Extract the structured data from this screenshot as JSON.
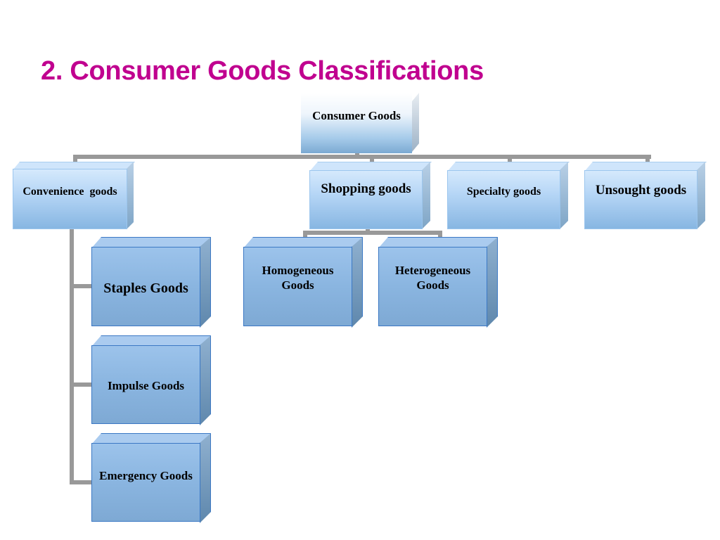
{
  "slide": {
    "title": "2. Consumer Goods Classifications"
  },
  "diagram": {
    "root": {
      "label": "Consumer Goods"
    },
    "categories": [
      {
        "label": "Convenience  goods"
      },
      {
        "label": "Shopping goods"
      },
      {
        "label": "Specialty goods"
      },
      {
        "label": "Unsought goods"
      }
    ],
    "convenience_children": [
      {
        "label": "Staples Goods"
      },
      {
        "label": "Impulse Goods"
      },
      {
        "label": "Emergency Goods"
      }
    ],
    "shopping_children": [
      {
        "label": "Homogeneous Goods"
      },
      {
        "label": "Heterogeneous Goods"
      }
    ],
    "colors": {
      "title": "#c0008f",
      "connector": "#999999",
      "box_border_dark": "#3b78c4"
    }
  }
}
